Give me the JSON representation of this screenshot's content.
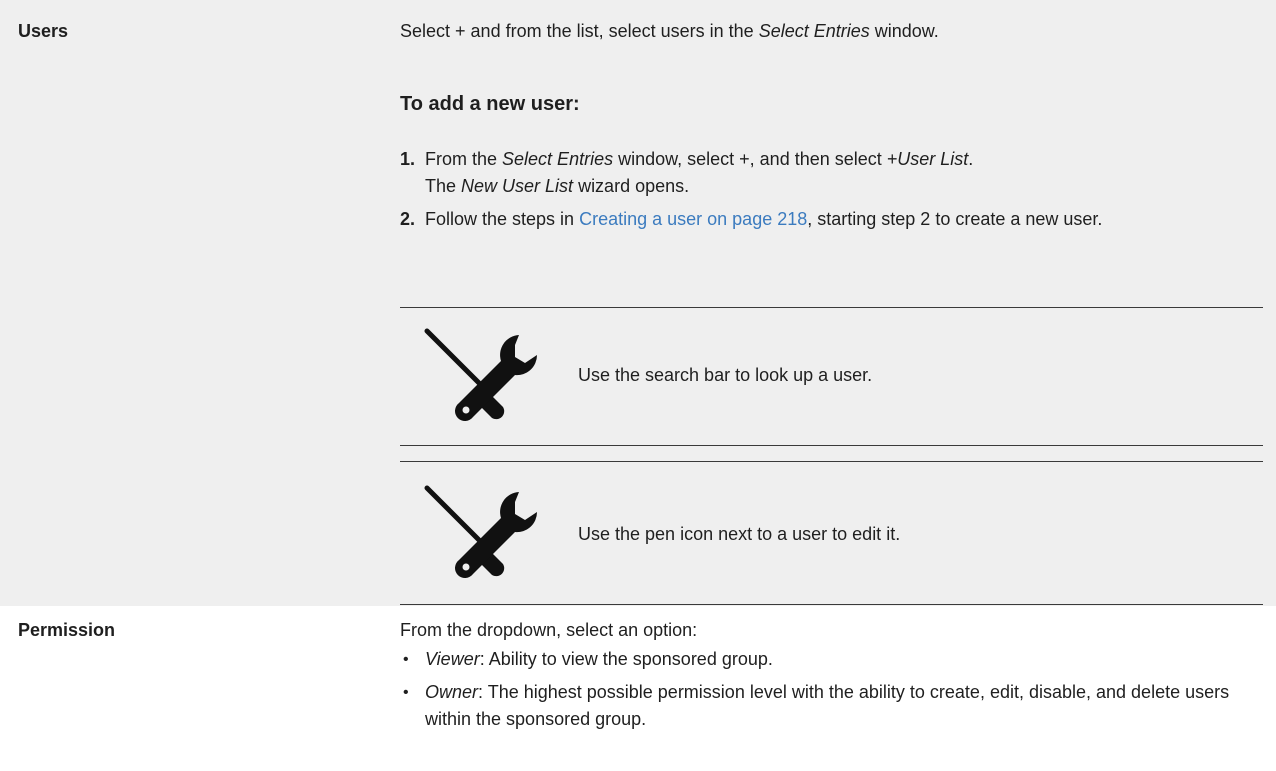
{
  "users_row": {
    "label": "Users",
    "intro_pre": "Select + and from the list, select users in the ",
    "intro_em": "Select Entries",
    "intro_post": " window.",
    "heading": "To add a new user:",
    "steps": [
      {
        "num": "1.",
        "pre": "From the ",
        "em1": "Select Entries",
        "mid": " window, select +, and then select ",
        "em2": "+User List",
        "post": ".",
        "line2_pre": "The ",
        "line2_em": "New User List",
        "line2_post": " wizard opens."
      },
      {
        "num": "2.",
        "pre": "Follow the steps in ",
        "link": "Creating a user on page 218",
        "post": ", starting step 2 to create a new user."
      }
    ],
    "notes": [
      {
        "icon": "tools-icon",
        "text": "Use the search bar to look up a user."
      },
      {
        "icon": "tools-icon",
        "text": "Use the pen icon next to a user to edit it."
      }
    ]
  },
  "permission_row": {
    "label": "Permission",
    "intro": "From the dropdown, select an option:",
    "options": [
      {
        "bullet": "•",
        "name": "Viewer",
        "desc": ": Ability to view the sponsored group."
      },
      {
        "bullet": "•",
        "name": "Owner",
        "desc": ": The highest possible permission level with the ability to create, edit, disable, and delete users within the sponsored group."
      }
    ]
  }
}
